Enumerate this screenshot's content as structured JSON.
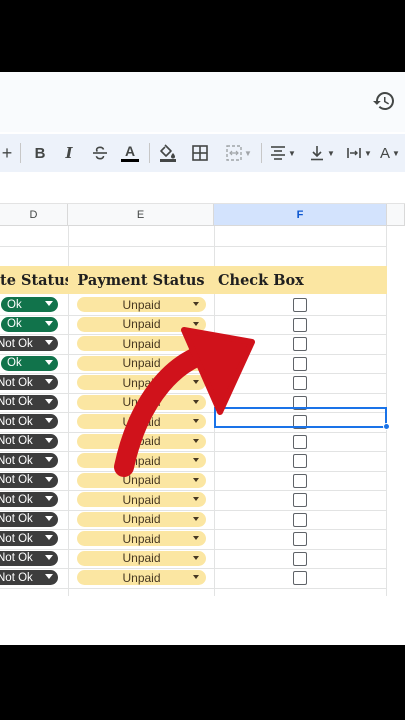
{
  "toolbar": {
    "plus_label": "+",
    "bold_label": "B",
    "italic_label": "I",
    "text_color_label": "A",
    "text_color_bar": "#000000",
    "text_rotate_label": "A"
  },
  "columns": [
    {
      "letter": "D",
      "selected": false
    },
    {
      "letter": "E",
      "selected": false
    },
    {
      "letter": "F",
      "selected": true
    }
  ],
  "table": {
    "headers": {
      "date_status": "te Status",
      "payment_status": "Payment Status",
      "check_box": "Check Box"
    },
    "rows": [
      {
        "date_status": "Ok",
        "status_type": "ok",
        "payment": "Unpaid",
        "checked": false
      },
      {
        "date_status": "Ok",
        "status_type": "ok",
        "payment": "Unpaid",
        "checked": false
      },
      {
        "date_status": "Not Ok",
        "status_type": "notok",
        "payment": "Unpaid",
        "checked": false
      },
      {
        "date_status": "Ok",
        "status_type": "ok",
        "payment": "Unpaid",
        "checked": false
      },
      {
        "date_status": "Not Ok",
        "status_type": "notok",
        "payment": "Unpaid",
        "checked": false
      },
      {
        "date_status": "Not Ok",
        "status_type": "notok",
        "payment": "Unpaid",
        "checked": false
      },
      {
        "date_status": "Not Ok",
        "status_type": "notok",
        "payment": "Unpaid",
        "checked": false
      },
      {
        "date_status": "Not Ok",
        "status_type": "notok",
        "payment": "Unpaid",
        "checked": false
      },
      {
        "date_status": "Not Ok",
        "status_type": "notok",
        "payment": "Unpaid",
        "checked": false
      },
      {
        "date_status": "Not Ok",
        "status_type": "notok",
        "payment": "Unpaid",
        "checked": false
      },
      {
        "date_status": "Not Ok",
        "status_type": "notok",
        "payment": "Unpaid",
        "checked": false
      },
      {
        "date_status": "Not Ok",
        "status_type": "notok",
        "payment": "Unpaid",
        "checked": false
      },
      {
        "date_status": "Not Ok",
        "status_type": "notok",
        "payment": "Unpaid",
        "checked": false
      },
      {
        "date_status": "Not Ok",
        "status_type": "notok",
        "payment": "Unpaid",
        "checked": false
      },
      {
        "date_status": "Not Ok",
        "status_type": "notok",
        "payment": "Unpaid",
        "checked": false
      }
    ]
  },
  "colors": {
    "ok_chip": "#11734b",
    "notok_chip": "#3d3d3d",
    "header_fill": "#fbe6a2",
    "selection": "#1a73e8",
    "annotation_arrow": "#d0121b"
  },
  "icons": [
    "version-history-icon",
    "strikethrough-icon",
    "fill-color-icon",
    "borders-icon",
    "merge-cells-icon",
    "horizontal-align-icon",
    "vertical-align-icon",
    "text-wrap-icon",
    "text-rotation-icon"
  ]
}
